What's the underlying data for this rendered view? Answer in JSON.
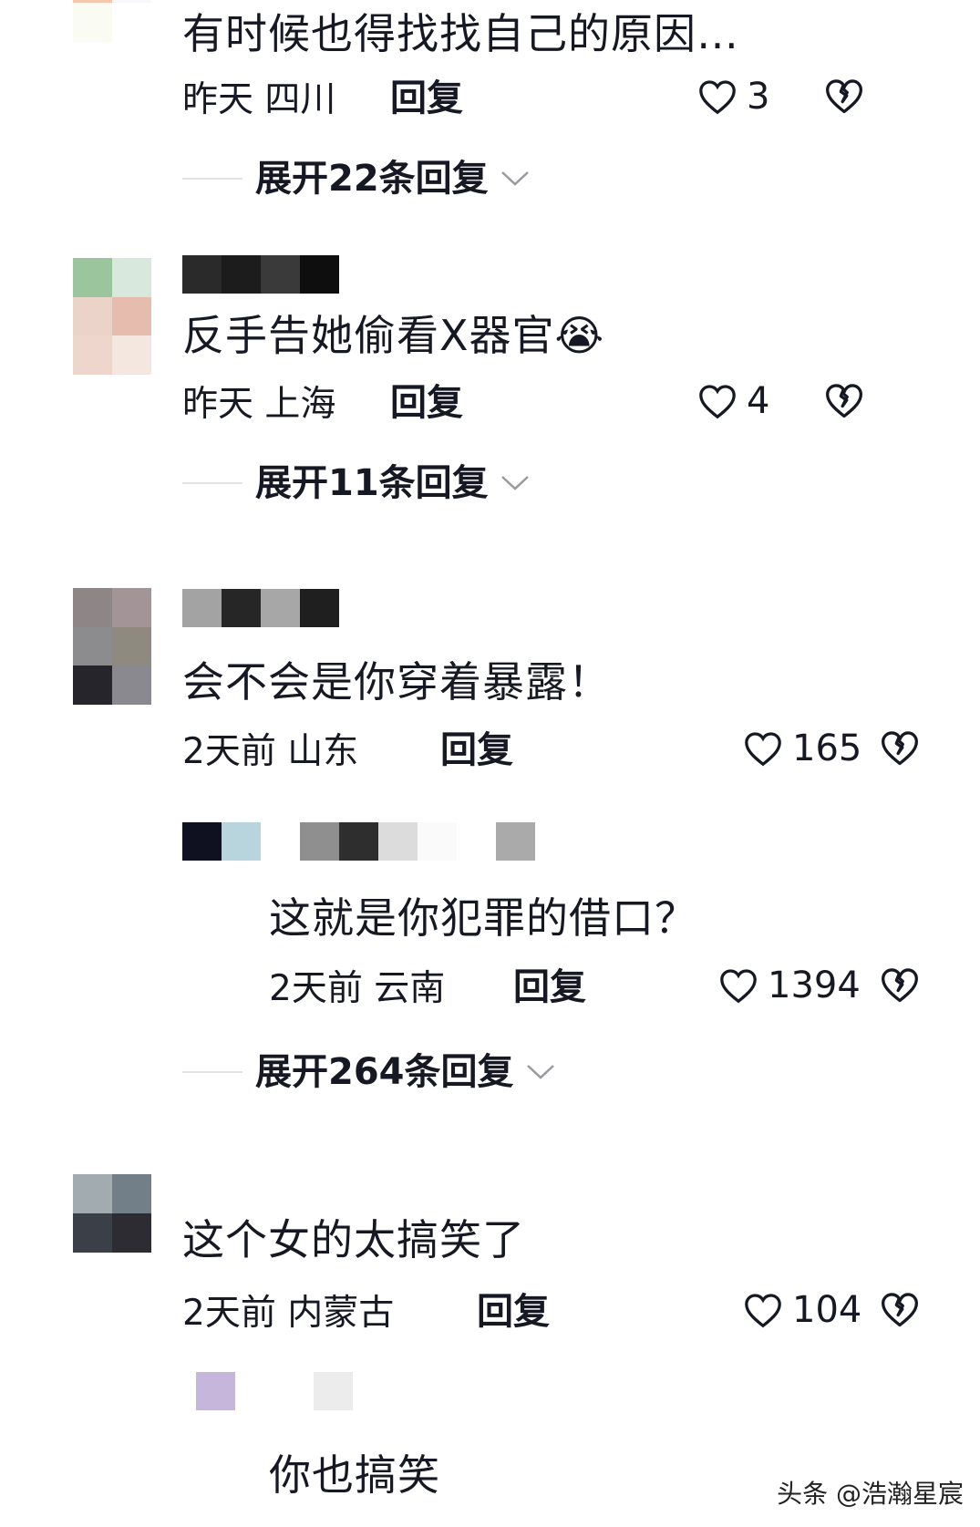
{
  "comments": [
    {
      "text": "有时候也得找找自己的原因…",
      "time": "昨天",
      "location": "四川",
      "reply_label": "回复",
      "likes": "3",
      "expand_label": "展开22条回复"
    },
    {
      "text": "反手告她偷看X器官😭",
      "time": "昨天",
      "location": "上海",
      "reply_label": "回复",
      "likes": "4",
      "expand_label": "展开11条回复"
    },
    {
      "text": "会不会是你穿着暴露！",
      "time": "2天前",
      "location": "山东",
      "reply_label": "回复",
      "likes": "165",
      "expand_label": "展开264条回复"
    },
    {
      "text": "这个女的太搞笑了",
      "time": "2天前",
      "location": "内蒙古",
      "reply_label": "回复",
      "likes": "104"
    }
  ],
  "replies": [
    {
      "text": "这就是你犯罪的借口？",
      "time": "2天前",
      "location": "云南",
      "reply_label": "回复",
      "likes": "1394"
    },
    {
      "text": "你也搞笑"
    }
  ],
  "watermark": "头条 @浩瀚星宸",
  "icons": {
    "like": "heart-outline-icon",
    "dislike": "broken-heart-icon",
    "expand": "chevron-down-icon"
  },
  "colors": {
    "text": "#161823",
    "divider": "#e3e3e5",
    "icon": "#161823"
  }
}
